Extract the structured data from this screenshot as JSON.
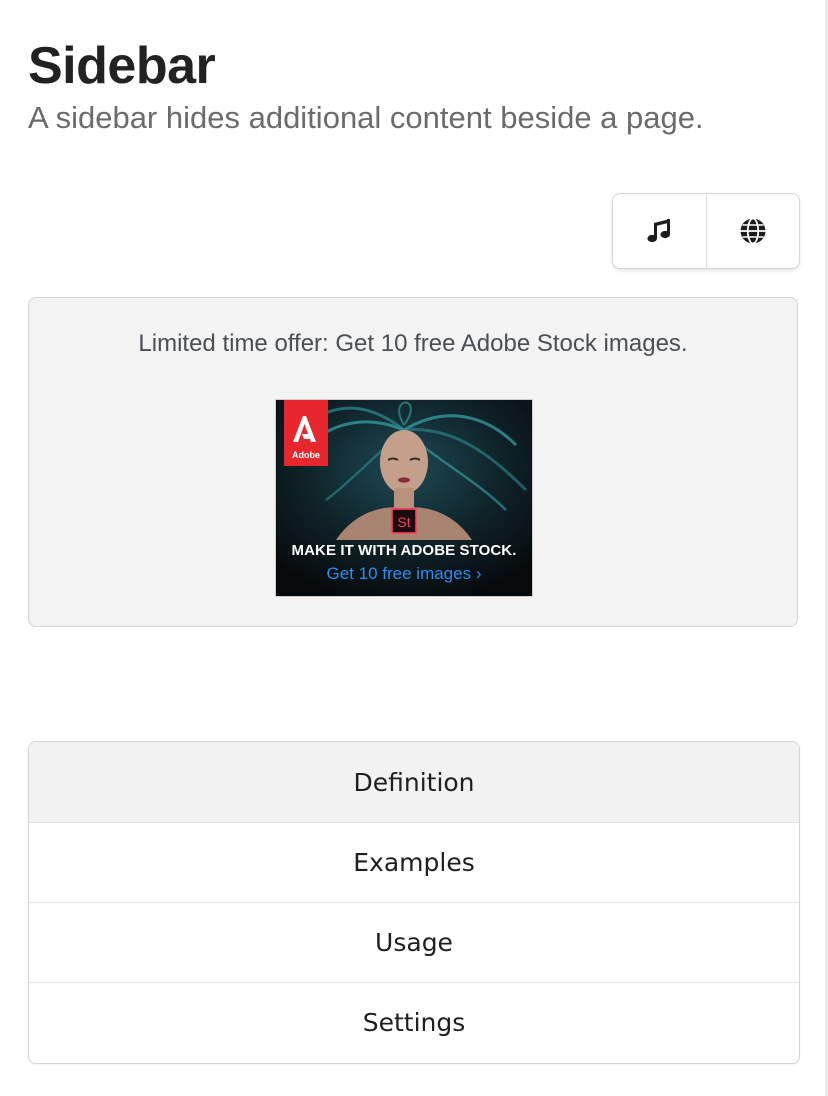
{
  "header": {
    "title": "Sidebar",
    "subtitle": "A sidebar hides additional content beside a page."
  },
  "theme_buttons": [
    {
      "icon": "music-icon"
    },
    {
      "icon": "globe-icon"
    }
  ],
  "ad": {
    "text": "Limited time offer: Get 10 free Adobe Stock images.",
    "banner": {
      "brand": "Adobe",
      "product_badge": "St",
      "headline": "MAKE IT WITH ADOBE STOCK.",
      "cta": "Get 10 free images ›",
      "brand_color": "#e8262d",
      "cta_color": "#2c8ef0"
    }
  },
  "menu": {
    "items": [
      {
        "label": "Definition",
        "active": true
      },
      {
        "label": "Examples",
        "active": false
      },
      {
        "label": "Usage",
        "active": false
      },
      {
        "label": "Settings",
        "active": false
      }
    ]
  }
}
